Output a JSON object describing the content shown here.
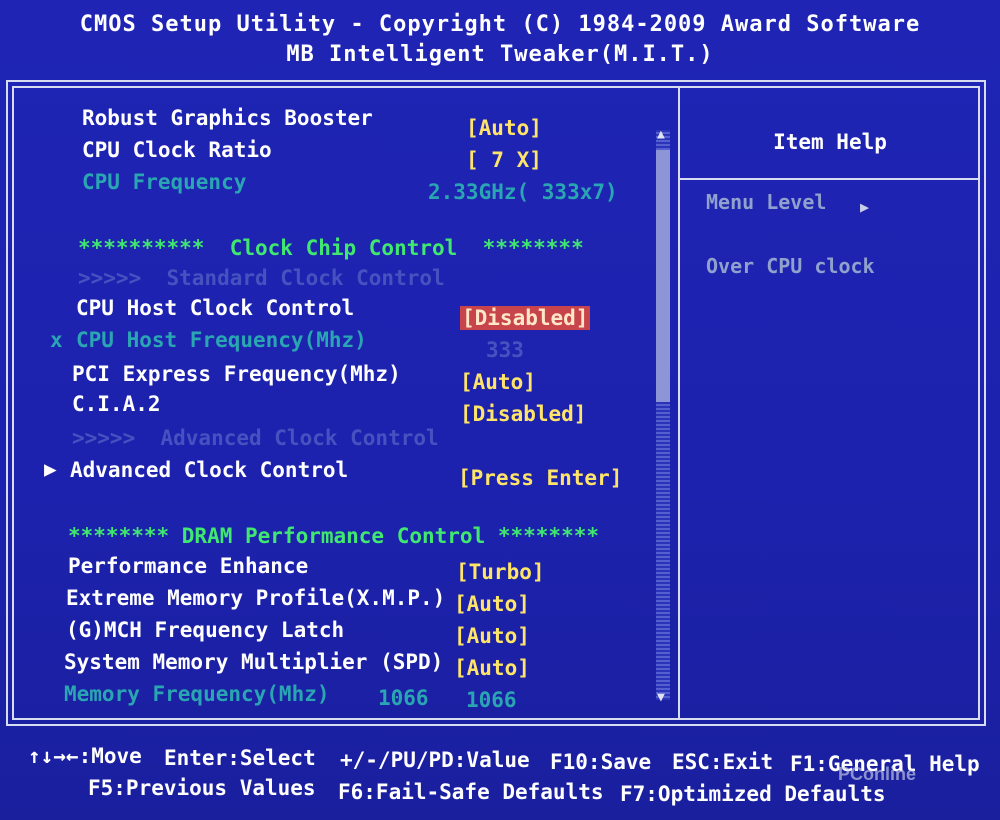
{
  "header": {
    "title": "CMOS Setup Utility - Copyright (C) 1984-2009 Award Software",
    "subtitle": "MB Intelligent Tweaker(M.I.T.)"
  },
  "settings": {
    "robust_graphics": {
      "label": "Robust Graphics Booster",
      "value": "[Auto]"
    },
    "cpu_clock_ratio": {
      "label": "CPU Clock Ratio",
      "value": "[ 7 X]"
    },
    "cpu_frequency": {
      "label": "CPU Frequency",
      "value": "2.33GHz( 333x7)"
    },
    "clock_chip_header": "**********  Clock Chip Control  ********",
    "standard_clock_header": ">>>>>  Standard Clock Control",
    "cpu_host_clock_control": {
      "label": "CPU Host Clock Control",
      "value": "[Disabled]"
    },
    "cpu_host_frequency": {
      "marker": "x",
      "label": "CPU Host Frequency(Mhz)",
      "value": "333"
    },
    "pci_express_frequency": {
      "label": "PCI Express Frequency(Mhz)",
      "value": "[Auto]"
    },
    "cia2": {
      "label": "C.I.A.2",
      "value": "[Disabled]"
    },
    "advanced_clock_header": ">>>>>  Advanced Clock Control",
    "advanced_clock_control": {
      "label": "Advanced Clock Control",
      "value": "[Press Enter]"
    },
    "dram_header": "******** DRAM Performance Control ********",
    "performance_enhance": {
      "label": "Performance Enhance",
      "value": "[Turbo]"
    },
    "xmp": {
      "label": "Extreme Memory Profile(X.M.P.)",
      "value": "[Auto]"
    },
    "gmch_latch": {
      "label": "(G)MCH Frequency Latch",
      "value": "[Auto]"
    },
    "system_memory_multiplier": {
      "label": "System Memory Multiplier (SPD)",
      "value": "[Auto]"
    },
    "memory_frequency": {
      "label": "Memory Frequency(Mhz)",
      "value1": "1066",
      "value2": "1066"
    }
  },
  "help": {
    "title": "Item Help",
    "menu_level": "Menu Level",
    "description": "Over CPU clock"
  },
  "footer": {
    "move": "↑↓→←:Move",
    "select": "Enter:Select",
    "value": "+/-/PU/PD:Value",
    "save": "F10:Save",
    "exit": "ESC:Exit",
    "general_help": "F1:General Help",
    "previous": "F5:Previous Values",
    "failsafe": "F6:Fail-Safe Defaults",
    "optimized": "F7:Optimized Defaults"
  },
  "watermark": "PConline"
}
